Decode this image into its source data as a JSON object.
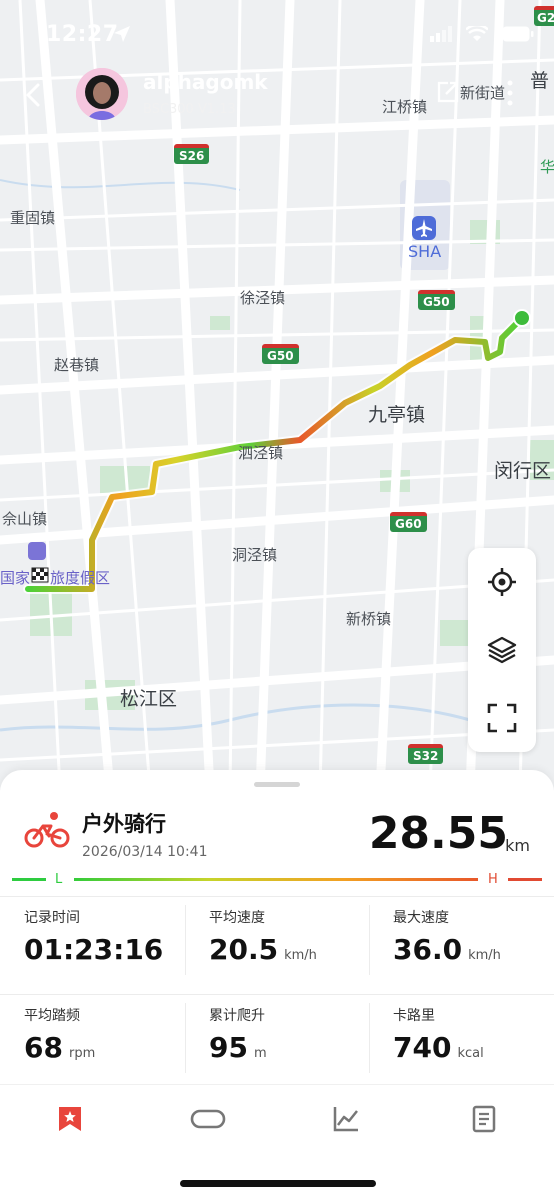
{
  "status": {
    "time": "12:27"
  },
  "header": {
    "username": "alphagomk",
    "device": "BSC300 V1.13"
  },
  "map": {
    "labels": {
      "jiangqiao": "江桥镇",
      "xinjiedao": "新街道",
      "pu": "普",
      "hua": "华",
      "zhonggu": "重固镇",
      "sha": "SHA",
      "xujing": "徐泾镇",
      "zhaoxiang": "赵巷镇",
      "jiuting": "九亭镇",
      "minhang": "闵行区",
      "sizeng": "泗泾镇",
      "sheshan": "佘山镇",
      "resort": "国家",
      "resort2": "旅度假区",
      "dongjing": "洞泾镇",
      "xinqiao": "新桥镇",
      "songjiang": "松江区"
    },
    "highways": {
      "s26": "S26",
      "g50a": "G50",
      "g50b": "G50",
      "g60": "G60",
      "s32": "S32",
      "g2": "G2"
    }
  },
  "activity": {
    "type": "户外骑行",
    "datetime": "2026/03/14 10:41",
    "distance": "28.55",
    "distance_unit": "km",
    "heat_low": "L",
    "heat_high": "H"
  },
  "stats": [
    {
      "label": "记录时间",
      "value": "01:23:16",
      "unit": ""
    },
    {
      "label": "平均速度",
      "value": "20.5",
      "unit": "km/h"
    },
    {
      "label": "最大速度",
      "value": "36.0",
      "unit": "km/h"
    },
    {
      "label": "平均踏频",
      "value": "68",
      "unit": "rpm"
    },
    {
      "label": "累计爬升",
      "value": "95",
      "unit": "m"
    },
    {
      "label": "卡路里",
      "value": "740",
      "unit": "kcal"
    }
  ],
  "tabs": [
    "bookmark-icon",
    "loop-icon",
    "chart-icon",
    "document-icon"
  ],
  "colors": {
    "accent": "#e8453c",
    "route_low": "#4cd137",
    "route_high": "#e8582a"
  }
}
